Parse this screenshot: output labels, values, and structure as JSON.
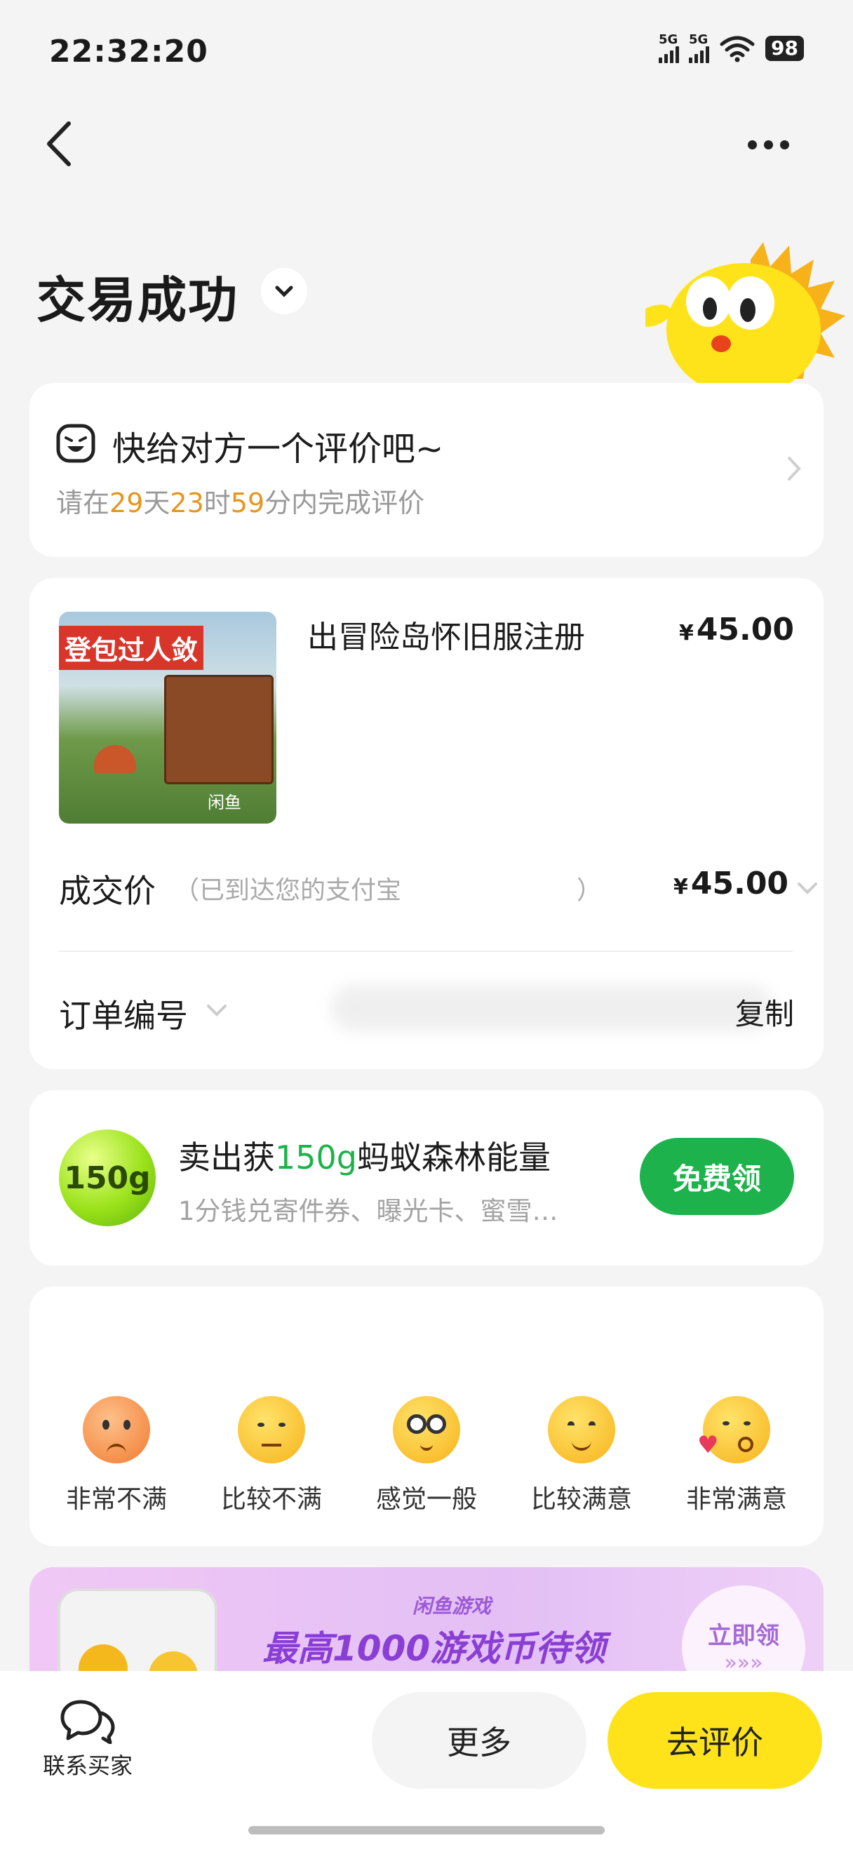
{
  "status_bar": {
    "time": "22:32:20",
    "signal1": "5G",
    "signal2": "5G",
    "battery": "98"
  },
  "header": {
    "title": "交易成功",
    "title_dropdown_icon": "chevron-down-icon",
    "back_icon": "back-arrow-icon",
    "more_icon": "more-dots-icon"
  },
  "review_prompt": {
    "title": "快给对方一个评价吧~",
    "sub_prefix": "请在",
    "days": "29",
    "days_unit": "天",
    "hours": "23",
    "hours_unit": "时",
    "minutes": "59",
    "minutes_unit": "分内完成评价"
  },
  "order": {
    "product_image_text": "登包过人敛",
    "product_watermark": "闲鱼",
    "product_title": "出冒险岛怀旧服注册",
    "product_price_symbol": "¥",
    "product_price": "45.00",
    "deal_price_label": "成交价",
    "deal_price_note": "（已到达您的支付宝",
    "deal_price_note_end": "）",
    "deal_price_symbol": "¥",
    "deal_price": "45.00",
    "order_no_label": "订单编号",
    "copy_label": "复制"
  },
  "promo": {
    "badge": "150g",
    "title_prefix": "卖出获",
    "title_highlight": "150g",
    "title_suffix": "蚂蚁森林能量",
    "subtitle": "1分钱兑寄件券、曝光卡、蜜雪…",
    "button": "免费领"
  },
  "ratings": [
    {
      "label": "非常不满",
      "icon": "very-dissatisfied-icon"
    },
    {
      "label": "比较不满",
      "icon": "dissatisfied-icon"
    },
    {
      "label": "感觉一般",
      "icon": "neutral-icon"
    },
    {
      "label": "比较满意",
      "icon": "satisfied-icon"
    },
    {
      "label": "非常满意",
      "icon": "very-satisfied-icon"
    }
  ],
  "banner": {
    "small_title": "闲鱼游戏",
    "headline": "最高1000游戏币待领",
    "button": "立即领",
    "button_arrows": "»»»"
  },
  "bottom_bar": {
    "contact_label": "联系买家",
    "more_button": "更多",
    "review_button": "去评价"
  },
  "colors": {
    "accent_yellow": "#ffe31a",
    "green": "#1db24b",
    "orange": "#e6951f"
  }
}
